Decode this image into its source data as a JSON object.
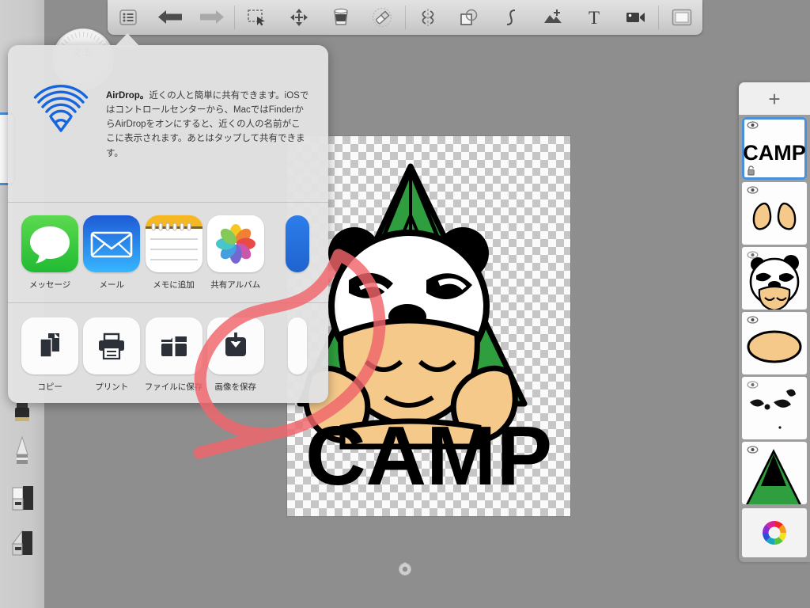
{
  "app": {
    "name": "drawing-app",
    "canvas_background": "transparent-checkerboard",
    "background_color": "#8e8e8e"
  },
  "toolbar": {
    "items": [
      {
        "icon": "list-icon",
        "label": "レイヤー一覧",
        "enabled": true
      },
      {
        "icon": "undo-arrow-icon",
        "label": "元に戻す",
        "enabled": true
      },
      {
        "icon": "redo-arrow-icon",
        "label": "やり直す",
        "enabled": false
      },
      {
        "icon": "selection-marquee-icon",
        "label": "選択",
        "enabled": true
      },
      {
        "icon": "move-icon",
        "label": "移動",
        "enabled": true
      },
      {
        "icon": "bucket-fill-icon",
        "label": "塗りつぶし",
        "enabled": true
      },
      {
        "icon": "eraser-icon",
        "label": "消しゴム",
        "enabled": true
      },
      {
        "icon": "symmetry-icon",
        "label": "対称",
        "enabled": true
      },
      {
        "icon": "shapes-icon",
        "label": "図形",
        "enabled": true
      },
      {
        "icon": "curve-icon",
        "label": "曲線",
        "enabled": true
      },
      {
        "icon": "add-image-icon",
        "label": "画像を追加",
        "enabled": true
      },
      {
        "icon": "text-icon",
        "label": "テキスト",
        "enabled": true
      },
      {
        "icon": "video-icon",
        "label": "ビデオ",
        "enabled": true
      },
      {
        "icon": "canvas-icon",
        "label": "キャンバス",
        "enabled": true
      }
    ]
  },
  "brush": {
    "size_value": "2.5",
    "dial_name": "brush-size-dial"
  },
  "tool_rail": {
    "tools": [
      {
        "icon": "ink-bottle-icon",
        "label": "インク"
      },
      {
        "icon": "pencil-tool-icon",
        "label": "鉛筆"
      },
      {
        "icon": "marker-tool-icon",
        "label": "マーカー"
      },
      {
        "icon": "brush-tool-icon",
        "label": "ブラシ"
      }
    ]
  },
  "share_sheet": {
    "airdrop": {
      "title": "AirDrop。",
      "body": "近くの人と簡単に共有できます。iOSではコントロールセンターから、MacではFinderからAirDropをオンにすると、近くの人の名前がここに表示されます。あとはタップして共有できます。",
      "icon": "airdrop-icon"
    },
    "apps": [
      {
        "label": "メッセージ",
        "icon": "messages-icon"
      },
      {
        "label": "メール",
        "icon": "mail-icon"
      },
      {
        "label": "メモに追加",
        "icon": "notes-icon"
      },
      {
        "label": "共有アルバム",
        "icon": "photos-icon"
      }
    ],
    "actions": [
      {
        "label": "コピー",
        "icon": "copy-icon"
      },
      {
        "label": "プリント",
        "icon": "printer-icon"
      },
      {
        "label": "ファイルに保存",
        "icon": "save-to-files-icon"
      },
      {
        "label": "画像を保存",
        "icon": "save-image-icon",
        "highlighted": true
      }
    ]
  },
  "annotation": {
    "type": "hand-drawn-circle-arrow",
    "color": "#f0656b",
    "points_to": "画像を保存"
  },
  "layers_panel": {
    "add_label": "+",
    "layers": [
      {
        "name": "CAMP",
        "thumb": "camp-text-thumb",
        "visible": true,
        "selected": true,
        "locked": false
      },
      {
        "name": "ears-layer",
        "thumb": "ears-thumb",
        "visible": true,
        "selected": false,
        "locked": false
      },
      {
        "name": "panda-face",
        "thumb": "panda-face-thumb",
        "visible": true,
        "selected": false,
        "locked": false
      },
      {
        "name": "face-oval",
        "thumb": "face-oval-thumb",
        "visible": true,
        "selected": false,
        "locked": false
      },
      {
        "name": "face-detail",
        "thumb": "face-detail-thumb",
        "visible": true,
        "selected": false,
        "locked": false
      },
      {
        "name": "tent-layer",
        "thumb": "tent-thumb",
        "visible": true,
        "selected": false,
        "locked": false
      }
    ],
    "color_wheel": "color-wheel-icon"
  },
  "artwork": {
    "text": "CAMP",
    "subject": "panda-hood-character-with-tent",
    "colors": {
      "tent_green": "#2e9e3e",
      "skin": "#f5c98a",
      "outline": "#000000",
      "text": "#000000"
    }
  }
}
